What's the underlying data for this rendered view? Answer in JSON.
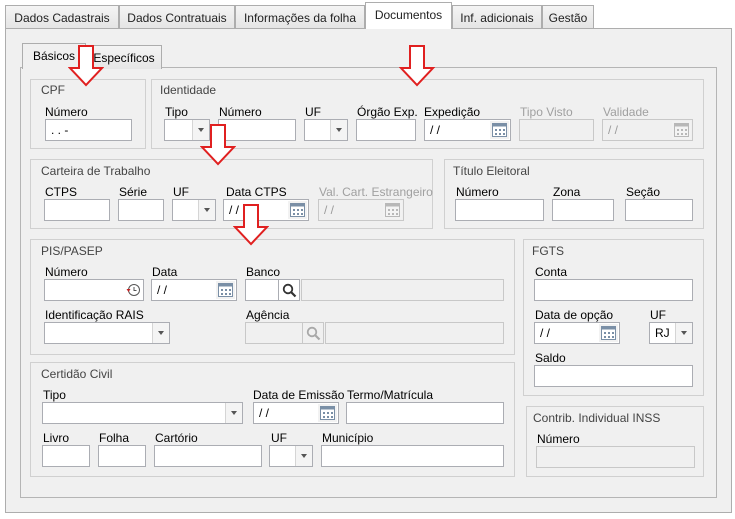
{
  "tabs": [
    "Dados Cadastrais",
    "Dados Contratuais",
    "Informações da folha",
    "Documentos",
    "Inf. adicionais",
    "Gestão"
  ],
  "subtabs": [
    "Básicos",
    "Específicos"
  ],
  "cpf": {
    "title": "CPF",
    "numero_label": "Número",
    "numero_value": " .  .  -"
  },
  "identidade": {
    "title": "Identidade",
    "tipo_label": "Tipo",
    "numero_label": "Número",
    "uf_label": "UF",
    "orgao_label": "Órgão Exp.",
    "expedicao_label": "Expedição",
    "expedicao_value": "/ /",
    "tipo_visto_label": "Tipo Visto",
    "validade_label": "Validade",
    "validade_value": "/ /"
  },
  "ctps": {
    "title": "Carteira de Trabalho",
    "ctps_label": "CTPS",
    "serie_label": "Série",
    "uf_label": "UF",
    "data_label": "Data CTPS",
    "data_value": "/ /",
    "val_label": "Val. Cart. Estrangeiro",
    "val_value": "/ /"
  },
  "titulo": {
    "title": "Título Eleitoral",
    "numero_label": "Número",
    "zona_label": "Zona",
    "secao_label": "Seção"
  },
  "pis": {
    "title": "PIS/PASEP",
    "numero_label": "Número",
    "data_label": "Data",
    "data_value": "/ /",
    "banco_label": "Banco",
    "rais_label": "Identificação RAIS",
    "agencia_label": "Agência"
  },
  "fgts": {
    "title": "FGTS",
    "conta_label": "Conta",
    "data_opcao_label": "Data de opção",
    "data_opcao_value": "/ /",
    "uf_label": "UF",
    "uf_value": "RJ",
    "saldo_label": "Saldo"
  },
  "certidao": {
    "title": "Certidão Civil",
    "tipo_label": "Tipo",
    "data_emissao_label": "Data de Emissão",
    "data_emissao_value": "/ /",
    "termo_label": "Termo/Matrícula",
    "livro_label": "Livro",
    "folha_label": "Folha",
    "cartorio_label": "Cartório",
    "uf_label": "UF",
    "municipio_label": "Município"
  },
  "inss": {
    "title": "Contrib. Individual INSS",
    "numero_label": "Número"
  },
  "colors": {
    "arrow": "#e02020",
    "tab_border": "#adadad",
    "panel": "#f0f0f0"
  }
}
